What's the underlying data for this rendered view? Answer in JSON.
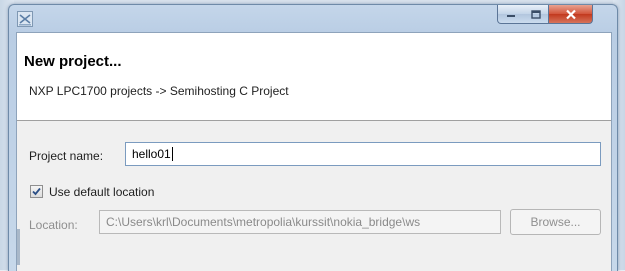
{
  "dialog": {
    "header_title": "New project...",
    "header_message": "NXP LPC1700 projects -> Semihosting C Project"
  },
  "form": {
    "project_name_label": "Project name:",
    "project_name_value": "hello01",
    "use_default_location_label": "Use default location",
    "use_default_location_checked": true,
    "location_label": "Location:",
    "location_value": "C:\\Users\\krl\\Documents\\metropolia\\kurssit\\nokia_bridge\\ws",
    "browse_label": "Browse..."
  },
  "icons": {
    "app": "eclipse-dialog-icon",
    "minimize": "minimize-icon",
    "maximize": "maximize-icon",
    "close": "close-icon",
    "check": "check-icon"
  },
  "colors": {
    "close_button": "#c2391e",
    "frame": "#b9cde4",
    "input_border": "#7b9bbf"
  }
}
